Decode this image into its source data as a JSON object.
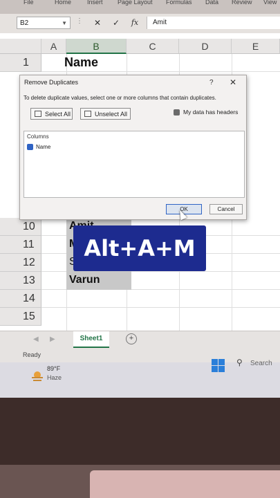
{
  "ribbon": {
    "tabs": [
      "File",
      "Home",
      "Insert",
      "Page Layout",
      "Formulas",
      "Data",
      "Review",
      "View"
    ]
  },
  "formula_bar": {
    "name_box": "B2",
    "cancel": "✕",
    "enter": "✓",
    "fx": "fx",
    "value": "Amit"
  },
  "columns": [
    "A",
    "B",
    "C",
    "D",
    "E"
  ],
  "rows": [
    "1",
    "10",
    "11",
    "12",
    "13",
    "14",
    "15"
  ],
  "cells": {
    "B1": "Name",
    "B10": "Amit",
    "B11": "M",
    "B12": "S",
    "B13": "Varun"
  },
  "dialog": {
    "title": "Remove Duplicates",
    "help": "?",
    "close": "✕",
    "instruction": "To delete duplicate values, select one or more columns that contain duplicates.",
    "select_all": "Select All",
    "unselect_all": "Unselect All",
    "my_data_has_headers": "My data has headers",
    "columns_label": "Columns",
    "column_items": [
      "Name"
    ],
    "ok": "OK",
    "cancel": "Cancel"
  },
  "overlay_banner": "Alt+A+M",
  "sheet_tabs": [
    "Sheet1"
  ],
  "add_sheet": "+",
  "status": "Ready",
  "taskbar": {
    "temperature": "89°F",
    "condition": "Haze",
    "search": "Search"
  },
  "colors": {
    "excel_green": "#217346",
    "banner_blue": "#1d2b8f",
    "windows_blue": "#2b7fd9",
    "checkbox_blue": "#2f63c4"
  }
}
